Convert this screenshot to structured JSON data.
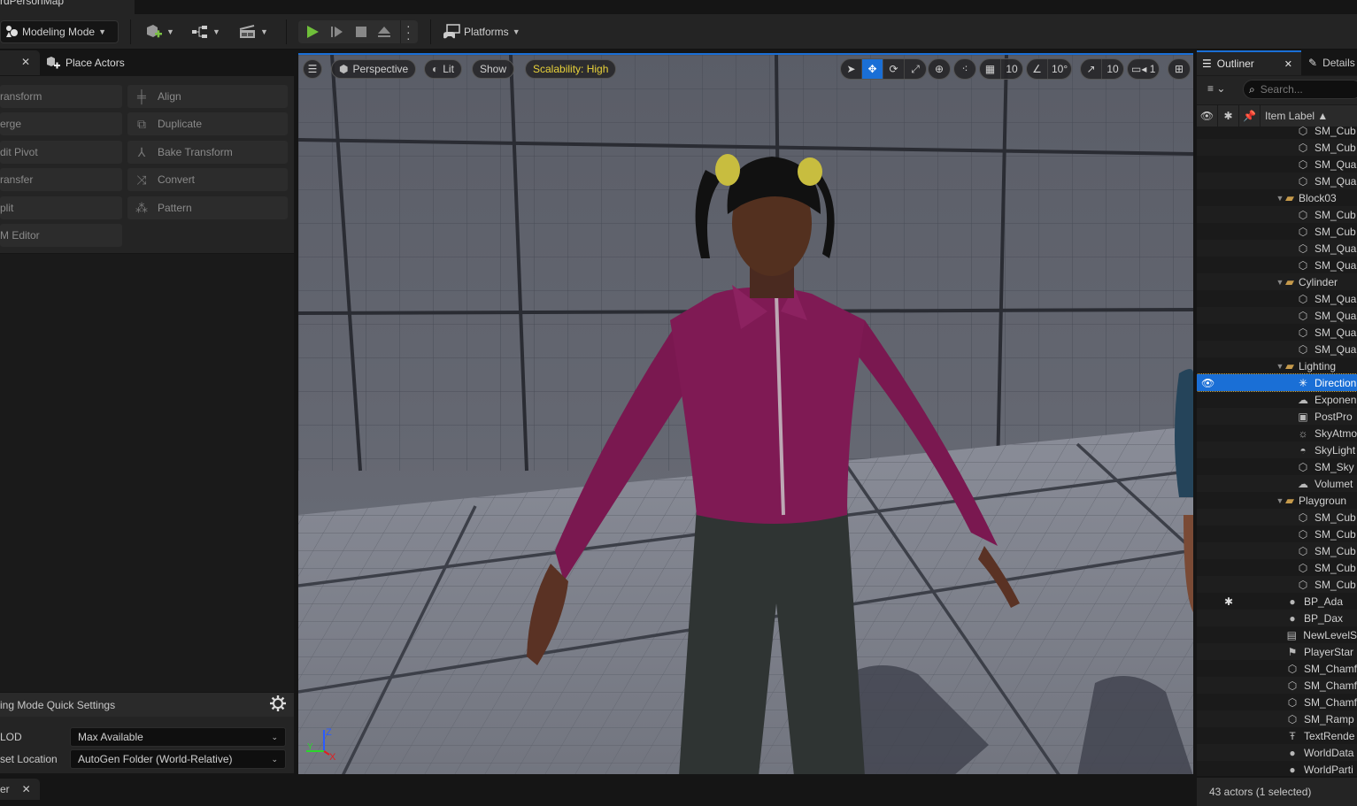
{
  "window": {
    "level_tab": "rdPersonMap"
  },
  "toolbar": {
    "mode_label": "Modeling Mode",
    "platforms_label": "Platforms",
    "colors": {
      "play_green": "#6fbf3a",
      "accent": "#1a6fd6"
    }
  },
  "left_panel": {
    "tab_label": "Place Actors",
    "tools_left": [
      "ransform",
      "erge",
      "dit Pivot",
      "ransfer",
      "plit",
      "M Editor"
    ],
    "tools_right": [
      {
        "label": "Align",
        "icon": "align-icon"
      },
      {
        "label": "Duplicate",
        "icon": "duplicate-icon"
      },
      {
        "label": "Bake Transform",
        "icon": "bake-transform-icon"
      },
      {
        "label": "Convert",
        "icon": "convert-icon"
      },
      {
        "label": "Pattern",
        "icon": "pattern-icon"
      }
    ],
    "quick_settings": {
      "title": "ing Mode Quick Settings",
      "lod_label": "LOD",
      "lod_value": "Max Available",
      "asset_location_label": "set Location",
      "asset_location_value": "AutoGen Folder (World-Relative)"
    },
    "bottom_tab": "er"
  },
  "viewport": {
    "perspective_label": "Perspective",
    "lit_label": "Lit",
    "show_label": "Show",
    "scalability_label": "Scalability: High",
    "scalability_color": "#e8d23a",
    "grid_snap": "10",
    "rotation_snap": "10°",
    "scale_snap": "10",
    "camera_speed": "1",
    "axis": {
      "x": "X",
      "y": "Y",
      "z": "Z"
    }
  },
  "outliner": {
    "tab_label": "Outliner",
    "details_label": "Details",
    "search_placeholder": "Search...",
    "column_label": "Item Label ▲",
    "rows": [
      {
        "label": "SM_Cub",
        "type": "mesh",
        "depth": 2
      },
      {
        "label": "SM_Cub",
        "type": "mesh",
        "depth": 2
      },
      {
        "label": "SM_Qua",
        "type": "mesh",
        "depth": 2
      },
      {
        "label": "SM_Qua",
        "type": "mesh",
        "depth": 2
      },
      {
        "label": "Block03",
        "type": "folder",
        "depth": 1
      },
      {
        "label": "SM_Cub",
        "type": "mesh",
        "depth": 2
      },
      {
        "label": "SM_Cub",
        "type": "mesh",
        "depth": 2
      },
      {
        "label": "SM_Qua",
        "type": "mesh",
        "depth": 2
      },
      {
        "label": "SM_Qua",
        "type": "mesh",
        "depth": 2
      },
      {
        "label": "Cylinder",
        "type": "folder",
        "depth": 1
      },
      {
        "label": "SM_Qua",
        "type": "mesh",
        "depth": 2
      },
      {
        "label": "SM_Qua",
        "type": "mesh",
        "depth": 2
      },
      {
        "label": "SM_Qua",
        "type": "mesh",
        "depth": 2
      },
      {
        "label": "SM_Qua",
        "type": "mesh",
        "depth": 2
      },
      {
        "label": "Lighting",
        "type": "folder",
        "depth": 1
      },
      {
        "label": "Direction",
        "type": "directional-light",
        "depth": 2,
        "selected": true
      },
      {
        "label": "Exponen",
        "type": "fog",
        "depth": 2
      },
      {
        "label": "PostPro",
        "type": "postprocess",
        "depth": 2
      },
      {
        "label": "SkyAtmo",
        "type": "sky-atmosphere",
        "depth": 2
      },
      {
        "label": "SkyLight",
        "type": "skylight",
        "depth": 2
      },
      {
        "label": "SM_Sky",
        "type": "mesh",
        "depth": 2
      },
      {
        "label": "Volumet",
        "type": "cloud",
        "depth": 2
      },
      {
        "label": "Playgroun",
        "type": "folder",
        "depth": 1
      },
      {
        "label": "SM_Cub",
        "type": "mesh",
        "depth": 2
      },
      {
        "label": "SM_Cub",
        "type": "mesh",
        "depth": 2
      },
      {
        "label": "SM_Cub",
        "type": "mesh",
        "depth": 2
      },
      {
        "label": "SM_Cub",
        "type": "mesh",
        "depth": 2
      },
      {
        "label": "SM_Cub",
        "type": "mesh",
        "depth": 2
      },
      {
        "label": "BP_Ada",
        "type": "pawn",
        "depth": 1,
        "starred": true
      },
      {
        "label": "BP_Dax",
        "type": "pawn",
        "depth": 1
      },
      {
        "label": "NewLevelS",
        "type": "sequence",
        "depth": 1
      },
      {
        "label": "PlayerStar",
        "type": "player-start",
        "depth": 1
      },
      {
        "label": "SM_Chamf",
        "type": "mesh",
        "depth": 1
      },
      {
        "label": "SM_Chamf",
        "type": "mesh",
        "depth": 1
      },
      {
        "label": "SM_Chamf",
        "type": "mesh",
        "depth": 1
      },
      {
        "label": "SM_Ramp",
        "type": "mesh",
        "depth": 1
      },
      {
        "label": "TextRende",
        "type": "text",
        "depth": 1
      },
      {
        "label": "WorldData",
        "type": "info",
        "depth": 1
      },
      {
        "label": "WorldParti",
        "type": "info",
        "depth": 1
      }
    ],
    "status": "43 actors (1 selected)"
  }
}
